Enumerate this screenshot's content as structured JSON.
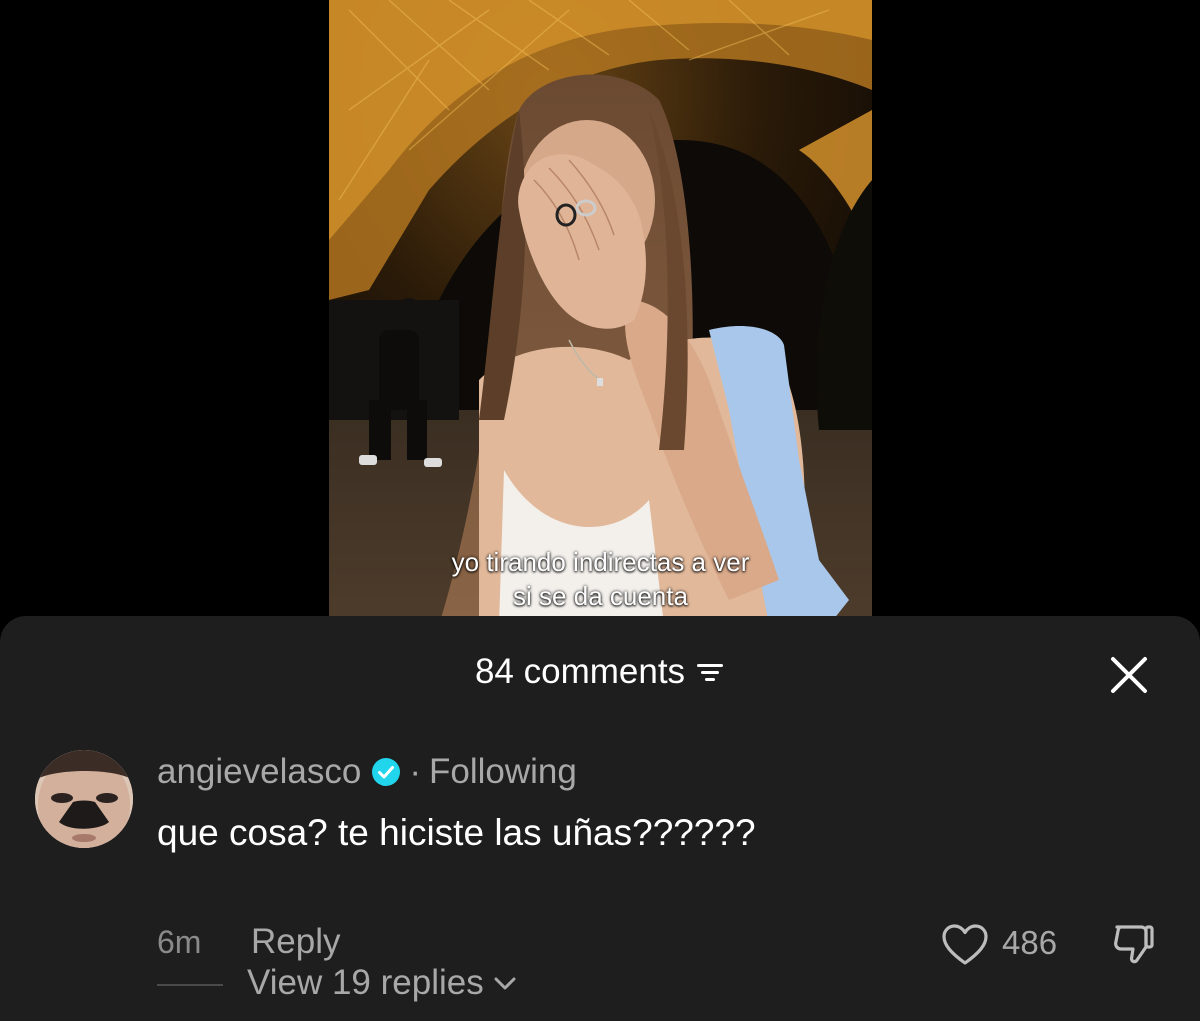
{
  "video": {
    "caption_line1": "yo tirando indirectas a ver",
    "caption_line2": "si se da cuenta"
  },
  "comments_header": {
    "count_label": "84 comments"
  },
  "icons": {
    "sort": "sort-filter-icon",
    "close": "close-icon",
    "verified": "verified-badge-icon",
    "like": "heart-icon",
    "dislike": "thumbs-down-icon",
    "expand": "chevron-down-icon"
  },
  "colors": {
    "sheet_background": "#1e1e1e",
    "verified_badge": "#20d5ec",
    "secondary_text": "#a8a8a8"
  },
  "comment": {
    "username": "angievelasco",
    "separator": "·",
    "follow_status": "Following",
    "text": "que cosa? te hiciste las uñas??????",
    "time": "6m",
    "reply_label": "Reply",
    "like_count": "486",
    "view_replies_label": "View 19 replies"
  }
}
